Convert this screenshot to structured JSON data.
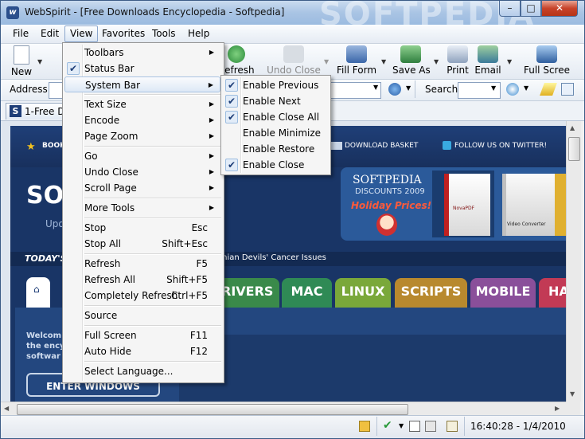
{
  "window": {
    "title": "WebSpirit - [Free Downloads Encyclopedia - Softpedia]",
    "watermark": "SOFTPEDIA",
    "app_icon_glyph": "w"
  },
  "caption": {
    "minimize": "–",
    "maximize": "□",
    "close": "✕"
  },
  "menubar": [
    "File",
    "Edit",
    "View",
    "Favorites",
    "Tools",
    "Help"
  ],
  "toolbar": {
    "new": "New",
    "refresh": "Refresh",
    "undo_close": "Undo Close",
    "fill_form": "Fill Form",
    "save_as": "Save As",
    "print": "Print",
    "email": "Email",
    "full_screen": "Full Scree"
  },
  "address": {
    "label": "Address",
    "search_label": "Search"
  },
  "tab": {
    "label": "1-Free Do",
    "icon_glyph": "S"
  },
  "site": {
    "bookmark": "BOOK",
    "download_basket": "DOWNLOAD BASKET",
    "twitter": "FOLLOW US ON TWITTER!",
    "logo": "SO",
    "logo_sub": "Upo",
    "banner_title": "SOFTPEDIA",
    "banner_sub": "DISCOUNTS 2009",
    "banner_promo": "Holiday Prices!",
    "product1": "NovaPDF",
    "product2": "Video Converter",
    "today": "TODAY'S",
    "headline": "anian Devils' Cancer Issues",
    "tabs": [
      "RIVERS",
      "MAC",
      "LINUX",
      "SCRIPTS",
      "MOBILE",
      "HA"
    ],
    "tab_colors": [
      "#3a8a4a",
      "#2f8a55",
      "#7aa83a",
      "#b8892e",
      "#8a4f9a",
      "#c23a55"
    ],
    "welcome": [
      "Welcom",
      "the ency",
      "softwar"
    ],
    "enter_windows": "ENTER WINDOWS"
  },
  "view_menu": [
    {
      "label": "Toolbars",
      "u": "T",
      "sub": true
    },
    {
      "label": "Status Bar",
      "checked": true
    },
    {
      "label": "System Bar",
      "highlight": true,
      "sub": true
    },
    {
      "sep": true
    },
    {
      "label": "Text Size",
      "u": "x",
      "sub": true,
      "icon": "#3f7f3f"
    },
    {
      "label": "Encode",
      "sub": true,
      "icon": "#4f6fb0"
    },
    {
      "label": "Page Zoom",
      "u": "Z",
      "sub": true
    },
    {
      "sep": true
    },
    {
      "label": "Go",
      "u": "G",
      "sub": true
    },
    {
      "label": "Undo Close",
      "u": "U",
      "sub": true,
      "icon": "#7a9a7a"
    },
    {
      "label": "Scroll Page",
      "sub": true
    },
    {
      "sep": true
    },
    {
      "label": "More Tools",
      "u": "M",
      "sub": true
    },
    {
      "sep": true
    },
    {
      "label": "Stop",
      "shortcut": "Esc",
      "icon": "#c23030"
    },
    {
      "label": "Stop All",
      "shortcut": "Shift+Esc",
      "icon": "#c25050"
    },
    {
      "sep": true
    },
    {
      "label": "Refresh",
      "shortcut": "F5",
      "icon": "#3a9a4a"
    },
    {
      "label": "Refresh All",
      "shortcut": "Shift+F5",
      "icon": "#3a8a6a"
    },
    {
      "label": "Completely Refresh",
      "shortcut": "Ctrl+F5"
    },
    {
      "sep": true
    },
    {
      "label": "Source"
    },
    {
      "sep": true
    },
    {
      "label": "Full Screen",
      "shortcut": "F11",
      "icon": "#3a6ab0"
    },
    {
      "label": "Auto Hide",
      "shortcut": "F12",
      "icon": "#5a8ac0"
    },
    {
      "sep": true
    },
    {
      "label": "Select Language..."
    }
  ],
  "system_bar_menu": [
    {
      "label": "Enable Previous",
      "checked": true
    },
    {
      "label": "Enable Next",
      "checked": true
    },
    {
      "label": "Enable Close All",
      "checked": true
    },
    {
      "label": "Enable Minimize",
      "checked": false
    },
    {
      "label": "Enable Restore",
      "checked": false
    },
    {
      "label": "Enable Close",
      "checked": true
    }
  ],
  "status": {
    "time": "16:40:28 - 1/4/2010"
  },
  "colors": {
    "accent": "#1d3d77",
    "site_bg": "#193566"
  }
}
